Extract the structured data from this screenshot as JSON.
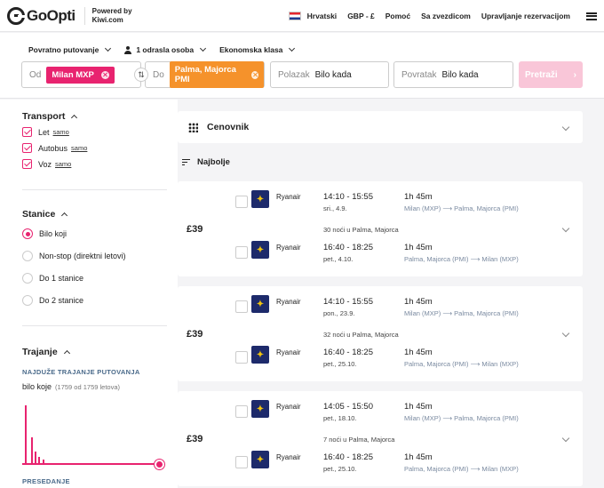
{
  "header": {
    "logo_text": "GoOpti",
    "powered_line1": "Powered by",
    "powered_line2": "Kiwi.com",
    "language": "Hrvatski",
    "currency": "GBP - £",
    "help": "Pomoć",
    "stars": "Sa zvezdicom",
    "manage": "Upravljanje rezervacijom"
  },
  "search": {
    "trip_type": "Povratno putovanje",
    "passengers": "1 odrasla osoba",
    "cabin": "Ekonomska klasa",
    "from_label": "Od",
    "from_value": "Milan MXP",
    "to_label": "Do",
    "to_value": "Palma, Majorca PMI",
    "depart_label": "Polazak",
    "depart_value": "Bilo kada",
    "return_label": "Povratak",
    "return_value": "Bilo kada",
    "search_button": "Pretraži"
  },
  "sidebar": {
    "transport_title": "Transport",
    "transport_items": [
      {
        "label": "Let",
        "only": "samo"
      },
      {
        "label": "Autobus",
        "only": "samo"
      },
      {
        "label": "Voz",
        "only": "samo"
      }
    ],
    "stops_title": "Stanice",
    "stops_options": [
      "Bilo koji",
      "Non-stop (direktni letovi)",
      "Do 1 stanice",
      "Do 2 stanice"
    ],
    "duration_title": "Trajanje",
    "duration_subtitle": "NAJDUŽE TRAJANJE PUTOVANJA",
    "duration_value": "bilo koje",
    "duration_count": "(1759 od 1759 letova)",
    "transfer_title": "PRESEDANJE"
  },
  "main": {
    "price_table": "Cenovnik",
    "sort_label": "Najbolje"
  },
  "results": [
    {
      "price": "£39",
      "nights": "30 noći u Palma, Majorca",
      "legs": [
        {
          "airline": "Ryanair",
          "time": "14:10 - 15:55",
          "date": "sri., 4.9.",
          "duration": "1h 45m",
          "route": "Milan (MXP) ⟶ Palma, Majorca (PMI)"
        },
        {
          "airline": "Ryanair",
          "time": "16:40 - 18:25",
          "date": "pet., 4.10.",
          "duration": "1h 45m",
          "route": "Palma, Majorca (PMI) ⟶ Milan (MXP)"
        }
      ]
    },
    {
      "price": "£39",
      "nights": "32 noći u Palma, Majorca",
      "legs": [
        {
          "airline": "Ryanair",
          "time": "14:10 - 15:55",
          "date": "pon., 23.9.",
          "duration": "1h 45m",
          "route": "Milan (MXP) ⟶ Palma, Majorca (PMI)"
        },
        {
          "airline": "Ryanair",
          "time": "16:40 - 18:25",
          "date": "pet., 25.10.",
          "duration": "1h 45m",
          "route": "Palma, Majorca (PMI) ⟶ Milan (MXP)"
        }
      ]
    },
    {
      "price": "£39",
      "nights": "7 noći u Palma, Majorca",
      "legs": [
        {
          "airline": "Ryanair",
          "time": "14:05 - 15:50",
          "date": "pet., 18.10.",
          "duration": "1h 45m",
          "route": "Milan (MXP) ⟶ Palma, Majorca (PMI)"
        },
        {
          "airline": "Ryanair",
          "time": "16:40 - 18:25",
          "date": "pet., 25.10.",
          "duration": "1h 45m",
          "route": "Palma, Majorca (PMI) ⟶ Milan (MXP)"
        }
      ]
    }
  ],
  "colors": {
    "accent": "#e8236f",
    "destination": "#f5922b",
    "ryanair": "#1d2a6b"
  },
  "icons": [
    "grid-icon",
    "sort-icon",
    "swap-icon",
    "person-icon",
    "menu-icon",
    "flag-icon"
  ]
}
